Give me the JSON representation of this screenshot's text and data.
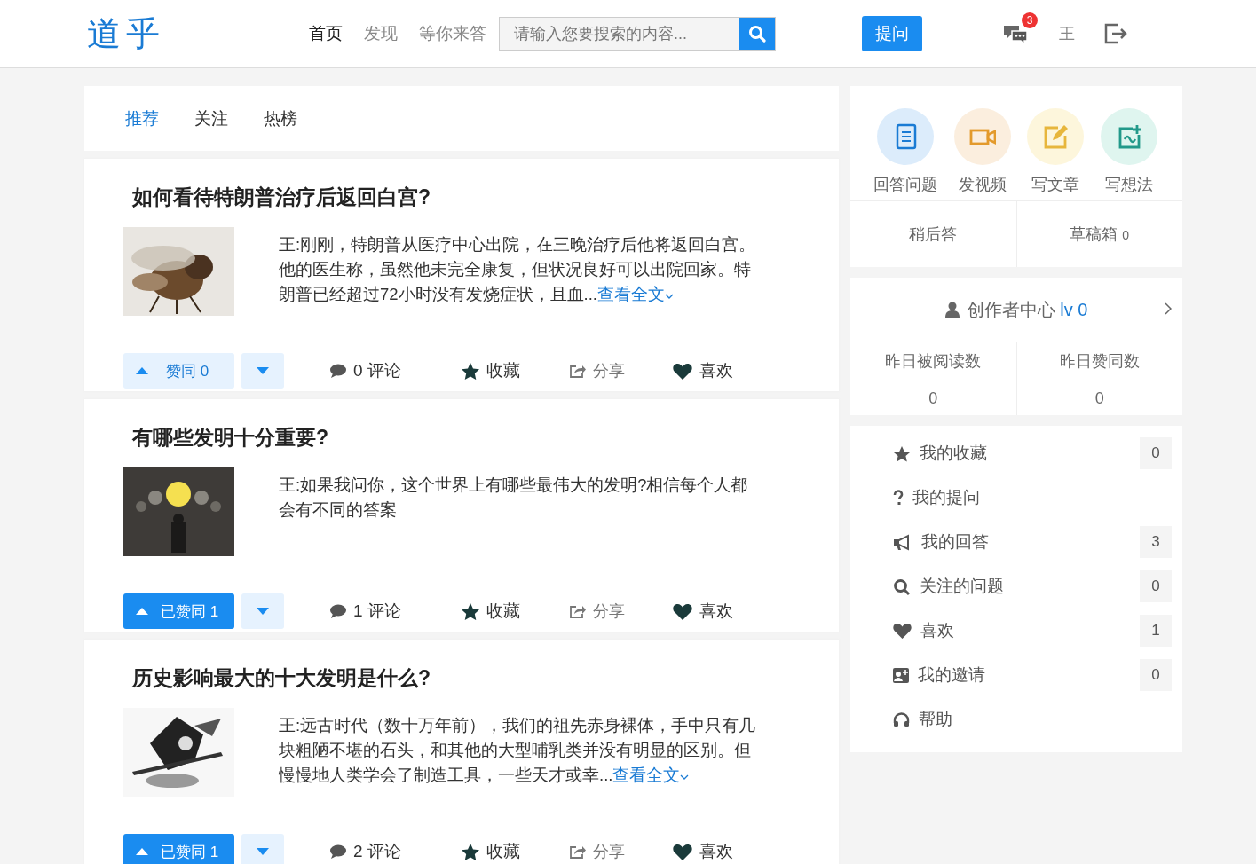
{
  "header": {
    "logo": "道乎",
    "nav": [
      {
        "label": "首页",
        "selected": true
      },
      {
        "label": "发现",
        "selected": false
      },
      {
        "label": "等你来答",
        "selected": false
      }
    ],
    "search": {
      "placeholder": "请输入您要搜索的内容..."
    },
    "ask_button": "提问",
    "message_badge": "3",
    "user": "王"
  },
  "feed_tabs": [
    {
      "label": "推荐",
      "selected": true
    },
    {
      "label": "关注",
      "selected": false
    },
    {
      "label": "热榜",
      "selected": false
    }
  ],
  "posts": [
    {
      "title": "如何看待特朗普治疗后返回白宫?",
      "excerpt": "王:刚刚，特朗普从医疗中心出院，在三晚治疗后他将返回白宫。他的医生称，虽然他未完全康复，但状况良好可以出院回家。特朗普已经超过72小时没有发烧症状，且血...",
      "more": "查看全文",
      "vote": "赞同 0",
      "voted": false,
      "comments": "0 评论",
      "collect": "收藏",
      "share": "分享",
      "like": "喜欢"
    },
    {
      "title": "有哪些发明十分重要?",
      "excerpt": "王:如果我问你，这个世界上有哪些最伟大的发明?相信每个人都会有不同的答案",
      "vote": "已赞同 1",
      "voted": true,
      "comments": "1 评论",
      "collect": "收藏",
      "share": "分享",
      "like": "喜欢"
    },
    {
      "title": "历史影响最大的十大发明是什么?",
      "excerpt": "王:远古时代（数十万年前），我们的祖先赤身裸体，手中只有几块粗陋不堪的石头，和其他的大型哺乳类并没有明显的区别。但慢慢地人类学会了制造工具，一些天才或幸...",
      "more": "查看全文",
      "vote": "已赞同 1",
      "voted": true,
      "comments": "2 评论",
      "collect": "收藏",
      "share": "分享",
      "like": "喜欢"
    }
  ],
  "sidebar": {
    "actions": [
      {
        "kind": "doc",
        "label": "回答问题"
      },
      {
        "kind": "video",
        "label": "发视频"
      },
      {
        "kind": "edit",
        "label": "写文章"
      },
      {
        "kind": "idea",
        "label": "写想法"
      }
    ],
    "later": "稍后答",
    "drafts": {
      "label": "草稿箱",
      "count": "0"
    },
    "creator": {
      "label": "创作者中心",
      "level": "lv 0"
    },
    "stats": [
      {
        "label": "昨日被阅读数",
        "value": "0"
      },
      {
        "label": "昨日赞同数",
        "value": "0"
      }
    ],
    "menu": [
      {
        "kind": "star",
        "label": "我的收藏",
        "count": "0"
      },
      {
        "kind": "question",
        "label": "我的提问"
      },
      {
        "kind": "bullhorn",
        "label": "我的回答",
        "count": "3"
      },
      {
        "kind": "search",
        "label": "关注的问题",
        "count": "0"
      },
      {
        "kind": "heart",
        "label": "喜欢",
        "count": "1"
      },
      {
        "kind": "invite",
        "label": "我的邀请",
        "count": "0"
      },
      {
        "kind": "headset",
        "label": "帮助"
      }
    ]
  }
}
